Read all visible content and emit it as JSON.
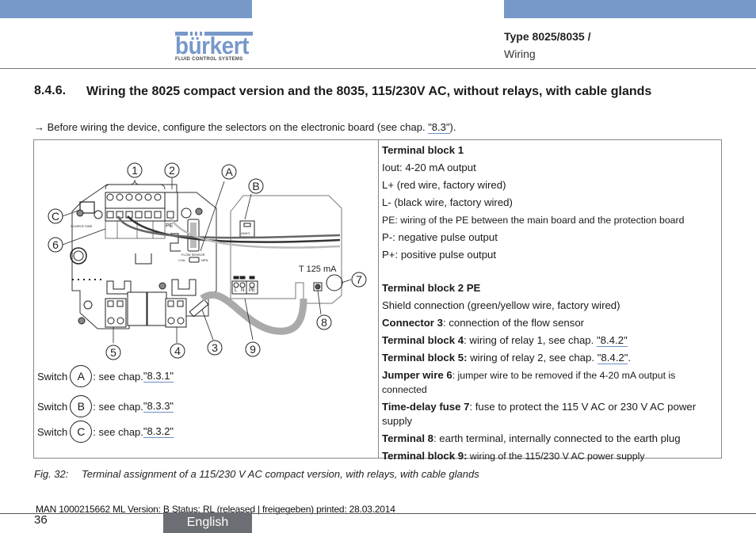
{
  "header": {
    "brand": "bürkert",
    "brand_tagline": "FLUID CONTROL SYSTEMS",
    "doc_type": "Type 8025/8035 /",
    "doc_section": "Wiring",
    "accent_color": "#7799c9"
  },
  "section": {
    "number": "8.4.6.",
    "title": "Wiring the 8025 compact version and the 8035, 115/230V AC, without relays, with cable glands"
  },
  "intro": {
    "arrow": "→",
    "text": "Before wiring the device, configure the selectors on the electronic board (see chap. ",
    "link": "\"8.3\"",
    "suffix": ")."
  },
  "diagram": {
    "callouts": [
      "1",
      "2",
      "A",
      "B",
      "C",
      "6",
      "7",
      "8",
      "5",
      "4",
      "3",
      "9"
    ],
    "fuse_label": "T 125 mA",
    "terminal_labels": [
      "L",
      "N",
      "PE"
    ],
    "pe_label": "PE",
    "flow_sensor_label": "FLOW SENSOR",
    "coil_label": "COIL",
    "npn_label": "NPN",
    "source_label": "SOURCE",
    "sink_label": "SINK",
    "switch_b_label": "ADEG"
  },
  "switches": [
    {
      "prefix": "Switch",
      "letter": "A",
      "text": ": see chap. ",
      "link": "\"8.3.1\""
    },
    {
      "prefix": "Switch",
      "letter": "B",
      "text": ": see chap. ",
      "link": "\"8.3.3\""
    },
    {
      "prefix": "Switch",
      "letter": "C",
      "text": ": see chap. ",
      "link": "\"8.3.2\""
    }
  ],
  "legend": {
    "tb1_title": "Terminal block 1",
    "tb1_lines": [
      "Iout: 4-20 mA output",
      "L+ (red wire, factory wired)",
      "L- (black wire, factory wired)",
      "PE: wiring of the PE between the main board and the protection board",
      "P-: negative pulse output",
      "P+: positive pulse output"
    ],
    "tb2_title": "Terminal block 2 PE",
    "tb2_text": "Shield connection (green/yellow wire, factory wired)",
    "c3_bold": "Connector 3",
    "c3_text": ": connection of the flow sensor",
    "tb4_bold": "Terminal block 4",
    "tb4_text": ": wiring of relay 1, see chap. ",
    "tb4_link": "\"8.4.2\"",
    "tb5_bold": "Terminal block 5:",
    "tb5_text": " wiring of relay 2, see chap. ",
    "tb5_link": "\"8.4.2\"",
    "tb5_suffix": ".",
    "j6_bold": "Jumper wire 6",
    "j6_text": ": jumper wire to be removed if the 4-20 mA output is connected",
    "f7_bold": "Time-delay fuse 7",
    "f7_text": ": fuse to protect the 115 V AC or 230 V AC power supply",
    "t8_bold": "Terminal 8",
    "t8_text": ": earth terminal, internally connected to the earth plug",
    "tb9_bold": "Terminal block 9:",
    "tb9_text": " wiring of the 115/230 V AC power supply"
  },
  "caption": {
    "label": "Fig. 32:",
    "text": "Terminal assignment of a 115/230 V AC compact version, with relays, with cable glands"
  },
  "footer": {
    "meta": "MAN  1000215662  ML  Version: B Status: RL (released | freigegeben)  printed: 28.03.2014",
    "page": "36",
    "language": "English"
  }
}
